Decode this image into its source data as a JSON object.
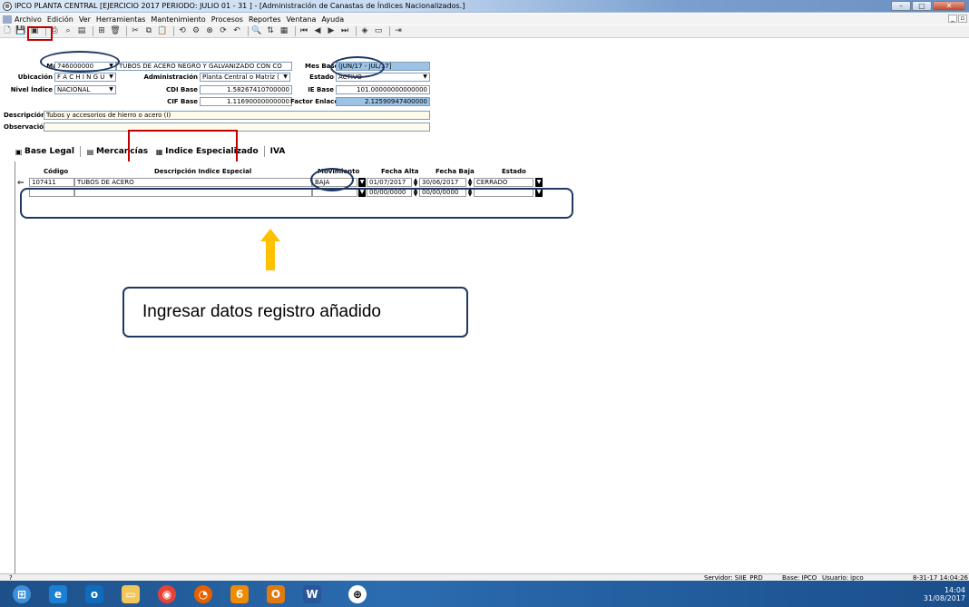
{
  "window": {
    "title": "IPCO PLANTA CENTRAL [EJERCICIO 2017 PERIODO: JULIO 01 - 31 ] - [Administración de Canastas de Índices Nacionalizados.]",
    "min": "–",
    "max": "▢",
    "close": "✕"
  },
  "menu": [
    "Archivo",
    "Edición",
    "Ver",
    "Herramientas",
    "Mantenimiento",
    "Procesos",
    "Reportes",
    "Ventana",
    "Ayuda"
  ],
  "form": {
    "material_label": "Material",
    "material_value": "746000000",
    "material_desc": "TUBOS DE ACERO NEGRO Y GALVANIZADO CON CO",
    "mes_base_label": "Mes Base",
    "mes_base_value": "(JUN/17 - JUL/17]",
    "ubicacion_label": "Ubicación",
    "ubicacion_value": "F A C H I N G U",
    "administracion_label": "Administración",
    "administracion_value": "Planta Central o Matriz (",
    "estado_label": "Estado",
    "estado_value": "ACTIVO",
    "nivel_label": "Nivel Índice",
    "nivel_value": "NACIONAL",
    "cdi_label": "CDI Base",
    "cdi_value": "1.58267410700000",
    "ie_label": "IE Base",
    "ie_value": "101.00000000000000",
    "cif_label": "CIF Base",
    "cif_value": "1.11690000000000",
    "factor_label": "Factor Enlace",
    "factor_value": "2.12590947400000",
    "descripcion_label": "Descripción",
    "descripcion_value": "Tubos y accesorios de hierro o acero (I)",
    "observacion_label": "Observación",
    "observacion_value": ""
  },
  "tabs": [
    "Base Legal",
    "Mercancías",
    "Indice Especializado",
    "IVA"
  ],
  "grid": {
    "headers": [
      "Código",
      "Descripción Indice Especial",
      "Movimiento",
      "Fecha Alta",
      "Fecha Baja",
      "Estado"
    ],
    "rows": [
      {
        "codigo": "107411",
        "descripcion": "TUBOS DE ACERO",
        "movimiento": "BAJA",
        "fecha_alta": "01/07/2017",
        "fecha_baja": "30/06/2017",
        "estado": "CERRADO"
      },
      {
        "codigo": "",
        "descripcion": "",
        "movimiento": "",
        "fecha_alta": "00/00/0000",
        "fecha_baja": "00/00/0000",
        "estado": ""
      }
    ]
  },
  "callout": "Ingresar datos registro añadido",
  "status": {
    "left": "?",
    "servidor": "Servidor: SIIE_PRD",
    "base": "Base: IPCO",
    "usuario": "Usuario: ipco",
    "datetime": "8-31-17 14:04:26"
  },
  "tray": {
    "time": "14:04",
    "date": "31/08/2017"
  },
  "colors": {
    "annotation_red": "#c00000",
    "annotation_navy": "#1f3864",
    "arrow": "#ffc000",
    "highlight_field": "#9cc3e6"
  }
}
